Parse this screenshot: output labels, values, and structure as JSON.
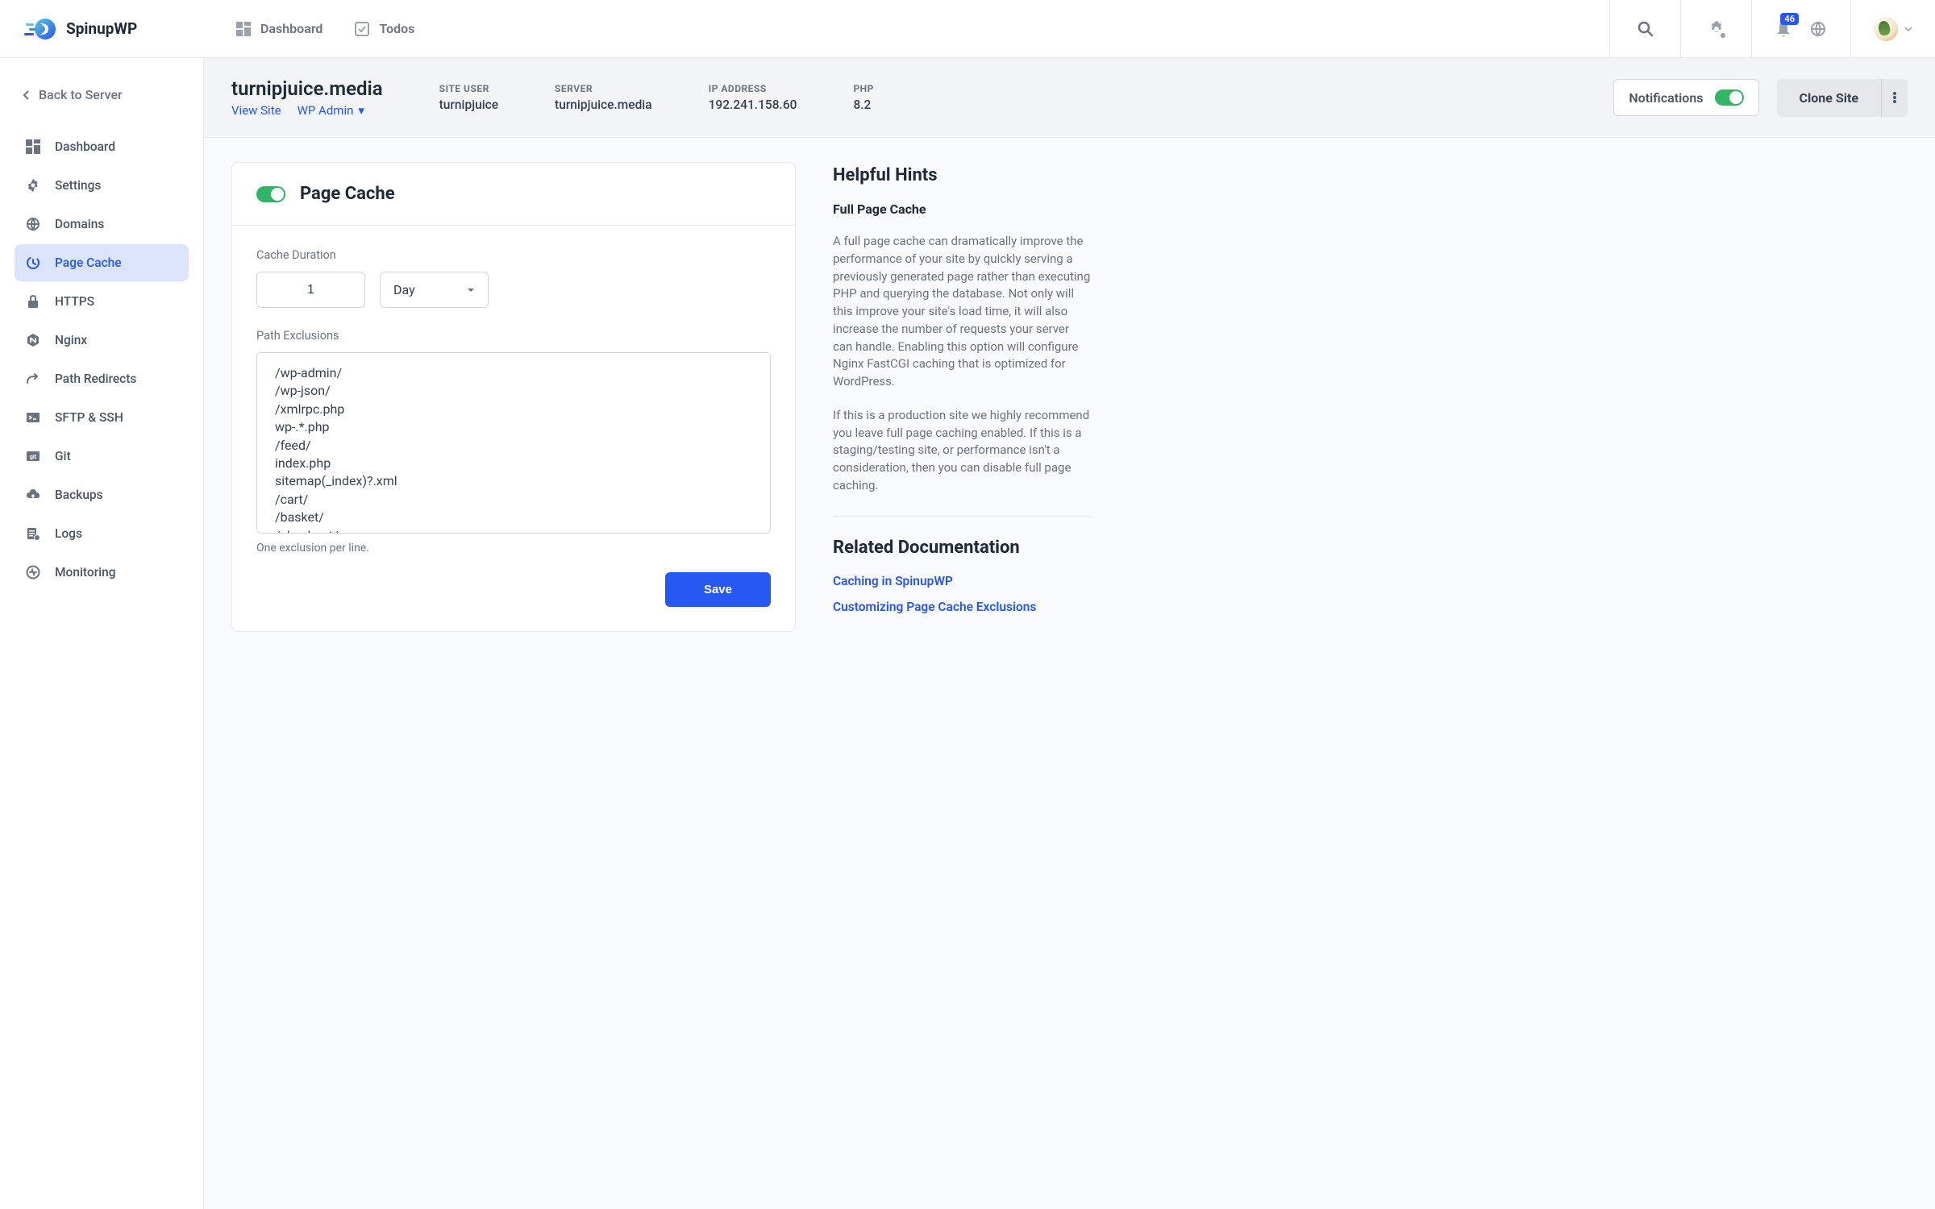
{
  "brand": "SpinupWP",
  "top_nav": {
    "dashboard": "Dashboard",
    "todos": "Todos"
  },
  "notifications_badge": "46",
  "sidebar": {
    "back": "Back to Server",
    "items": [
      {
        "label": "Dashboard"
      },
      {
        "label": "Settings"
      },
      {
        "label": "Domains"
      },
      {
        "label": "Page Cache"
      },
      {
        "label": "HTTPS"
      },
      {
        "label": "Nginx"
      },
      {
        "label": "Path Redirects"
      },
      {
        "label": "SFTP & SSH"
      },
      {
        "label": "Git"
      },
      {
        "label": "Backups"
      },
      {
        "label": "Logs"
      },
      {
        "label": "Monitoring"
      }
    ]
  },
  "site": {
    "title": "turnipjuice.media",
    "view_site": "View Site",
    "wp_admin": "WP Admin",
    "meta": {
      "site_user": {
        "label": "SITE USER",
        "value": "turnipjuice"
      },
      "server": {
        "label": "SERVER",
        "value": "turnipjuice.media"
      },
      "ip": {
        "label": "IP ADDRESS",
        "value": "192.241.158.60"
      },
      "php": {
        "label": "PHP",
        "value": "8.2"
      }
    },
    "notifications_label": "Notifications",
    "clone_label": "Clone Site"
  },
  "page_cache": {
    "title": "Page Cache",
    "duration_label": "Cache Duration",
    "duration_value": "1",
    "duration_unit": "Day",
    "exclusions_label": "Path Exclusions",
    "exclusions_value": "/wp-admin/\n/wp-json/\n/xmlrpc.php\nwp-.*.php\n/feed/\nindex.php\nsitemap(_index)?.xml\n/cart/\n/basket/\n/checkout/\n/my-account/",
    "exclusions_hint": "One exclusion per line.",
    "save_label": "Save"
  },
  "hints": {
    "title": "Helpful Hints",
    "subtitle": "Full Page Cache",
    "p1": "A full page cache can dramatically improve the performance of your site by quickly serving a previously generated page rather than executing PHP and querying the database. Not only will this improve your site's load time, it will also increase the number of requests your server can handle. Enabling this option will configure Nginx FastCGI caching that is optimized for WordPress.",
    "p2": "If this is a production site we highly recommend you leave full page caching enabled. If this is a staging/testing site, or performance isn't a consideration, then you can disable full page caching.",
    "docs_title": "Related Documentation",
    "link1": "Caching in SpinupWP",
    "link2": "Customizing Page Cache Exclusions"
  }
}
